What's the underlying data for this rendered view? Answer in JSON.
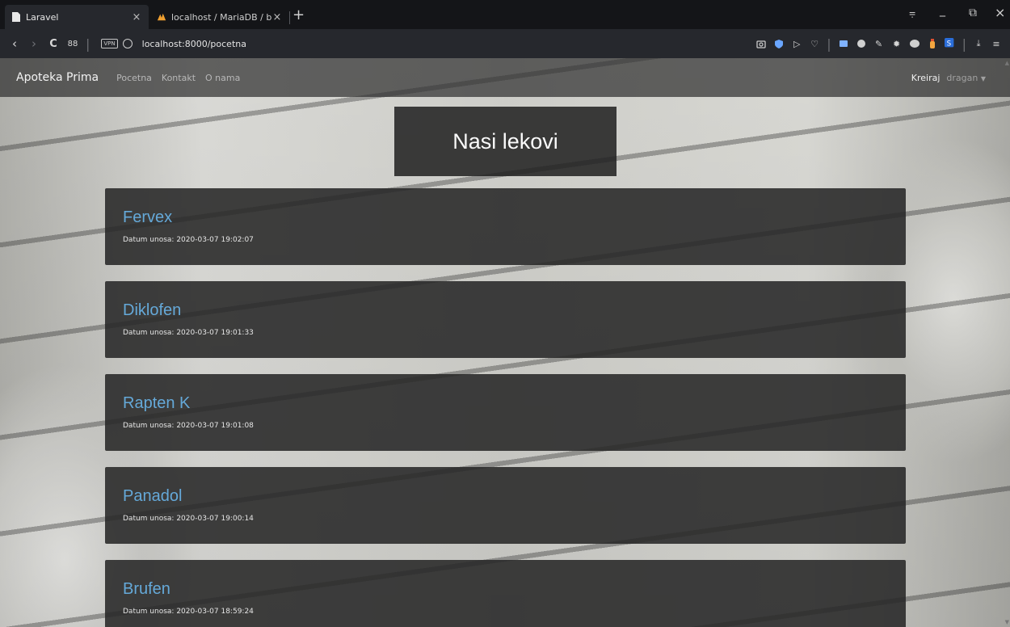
{
  "browser": {
    "tabs": [
      {
        "title": "Laravel",
        "close": "×",
        "active": true
      },
      {
        "title": "localhost / MariaDB / bazar",
        "close": "×",
        "active": false
      }
    ],
    "new_tab": "+",
    "url": "localhost:8000/pocetna",
    "vpn_badge": "VPN",
    "back": "‹",
    "forward": "›",
    "reload": "C",
    "speed_dial": "88",
    "window_controls": {
      "tabs_menu": "⩦",
      "minimize": "_",
      "restore": "⧉",
      "close": "×"
    },
    "extensions": [
      "camera-icon",
      "shield-icon",
      "send-icon",
      "heart-icon",
      "wallet-icon",
      "ball-icon",
      "pen-icon",
      "gear-icon",
      "puzzle-icon",
      "bottle-icon",
      "s-icon",
      "download-icon",
      "menu-icon"
    ]
  },
  "navbar": {
    "brand": "Apoteka Prima",
    "links": [
      "Pocetna",
      "Kontakt",
      "O nama"
    ],
    "create": "Kreiraj",
    "user": "dragan",
    "caret": "▼"
  },
  "main": {
    "heading": "Nasi lekovi",
    "items": [
      {
        "name": "Fervex",
        "date": "Datum unosa: 2020-03-07 19:02:07"
      },
      {
        "name": "Diklofen",
        "date": "Datum unosa: 2020-03-07 19:01:33"
      },
      {
        "name": "Rapten K",
        "date": "Datum unosa: 2020-03-07 19:01:08"
      },
      {
        "name": "Panadol",
        "date": "Datum unosa: 2020-03-07 19:00:14"
      },
      {
        "name": "Brufen",
        "date": "Datum unosa: 2020-03-07 18:59:24"
      }
    ]
  },
  "colors": {
    "link": "#65a9d9",
    "card_bg": "#262626",
    "navbar_bg": "#303030"
  }
}
